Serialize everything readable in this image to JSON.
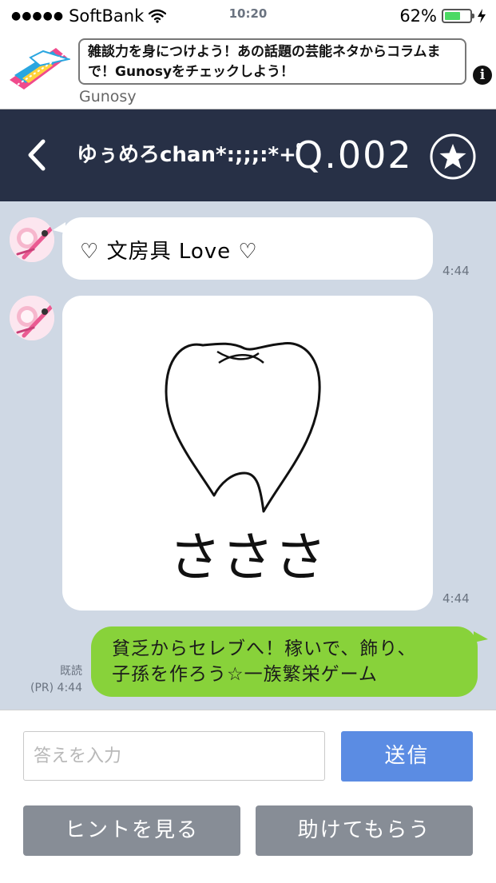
{
  "status_bar": {
    "signal_dots": "●●●●●",
    "carrier": "SoftBank",
    "time": "10:20",
    "battery_percent_text": "62%",
    "battery_level": 0.62,
    "icons": [
      "wifi-icon",
      "battery-icon",
      "charging-bolt-icon"
    ]
  },
  "ad": {
    "text": "雑談力を身につけよう！あの話題の芸能ネタからコラムまで！Gunosyをチェックしよう！",
    "brand": "Gunosy",
    "info_icon": "i"
  },
  "header": {
    "back_icon": "chevron-left-icon",
    "chat_name": "ゆぅめろchan*:;;;:*+ﾟ",
    "question_number": "Q.002",
    "star_icon": "star-icon"
  },
  "messages": [
    {
      "side": "left",
      "type": "text",
      "text": "♡ 文房具 Love ♡",
      "time": "4:44"
    },
    {
      "side": "left",
      "type": "image",
      "drawing_text": "さささ",
      "time": "4:44"
    },
    {
      "side": "right",
      "type": "text",
      "text_line1": "貧乏からセレブへ！稼いで、飾り、",
      "text_line2": "子孫を作ろう☆一族繁栄ゲーム",
      "read_label": "既読",
      "time": "(PR) 4:44"
    }
  ],
  "input": {
    "placeholder": "答えを入力",
    "send_label": "送信",
    "hint_label": "ヒントを見る",
    "help_label": "助けてもらう"
  },
  "colors": {
    "header_bg": "#273046",
    "chat_bg": "#cfd8e4",
    "outgoing_bubble": "#88d23a",
    "send_button": "#5b8ce3",
    "gray_button": "#878d96"
  }
}
